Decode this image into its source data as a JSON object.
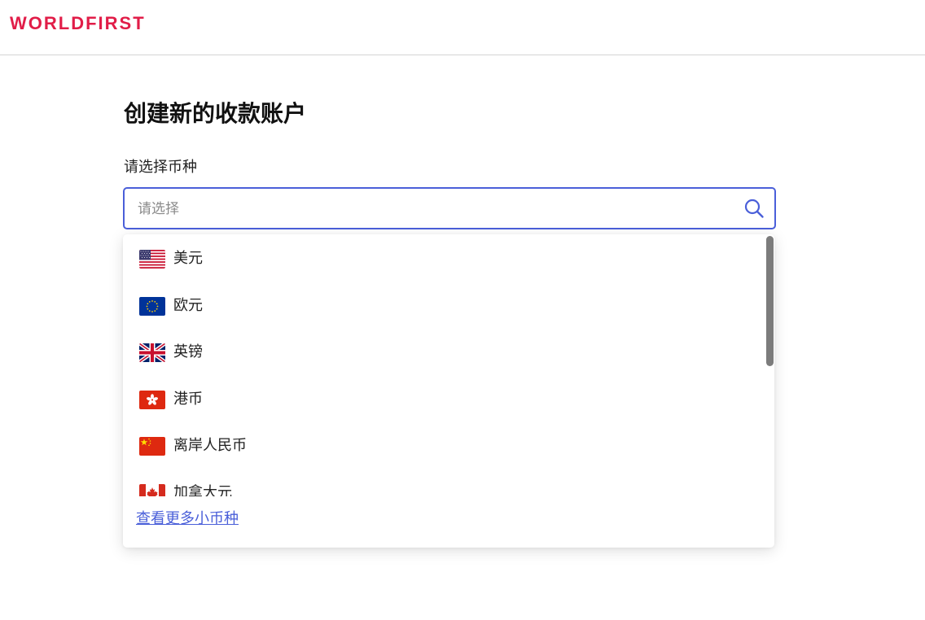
{
  "header": {
    "logo_text": "WORLDFIRST"
  },
  "main": {
    "title": "创建新的收款账户",
    "currency_label": "请选择币种",
    "search": {
      "placeholder": "请选择",
      "value": ""
    }
  },
  "dropdown": {
    "options": [
      {
        "label": "美元",
        "flag_icon": "us-flag-icon"
      },
      {
        "label": "欧元",
        "flag_icon": "eu-flag-icon"
      },
      {
        "label": "英镑",
        "flag_icon": "uk-flag-icon"
      },
      {
        "label": "港币",
        "flag_icon": "hk-flag-icon"
      },
      {
        "label": "离岸人民币",
        "flag_icon": "cn-flag-icon"
      },
      {
        "label": "加拿大元",
        "flag_icon": "ca-flag-icon"
      }
    ],
    "more_link": "查看更多小币种"
  },
  "colors": {
    "brand": "#e11d48",
    "accent": "#4a5fd9"
  }
}
